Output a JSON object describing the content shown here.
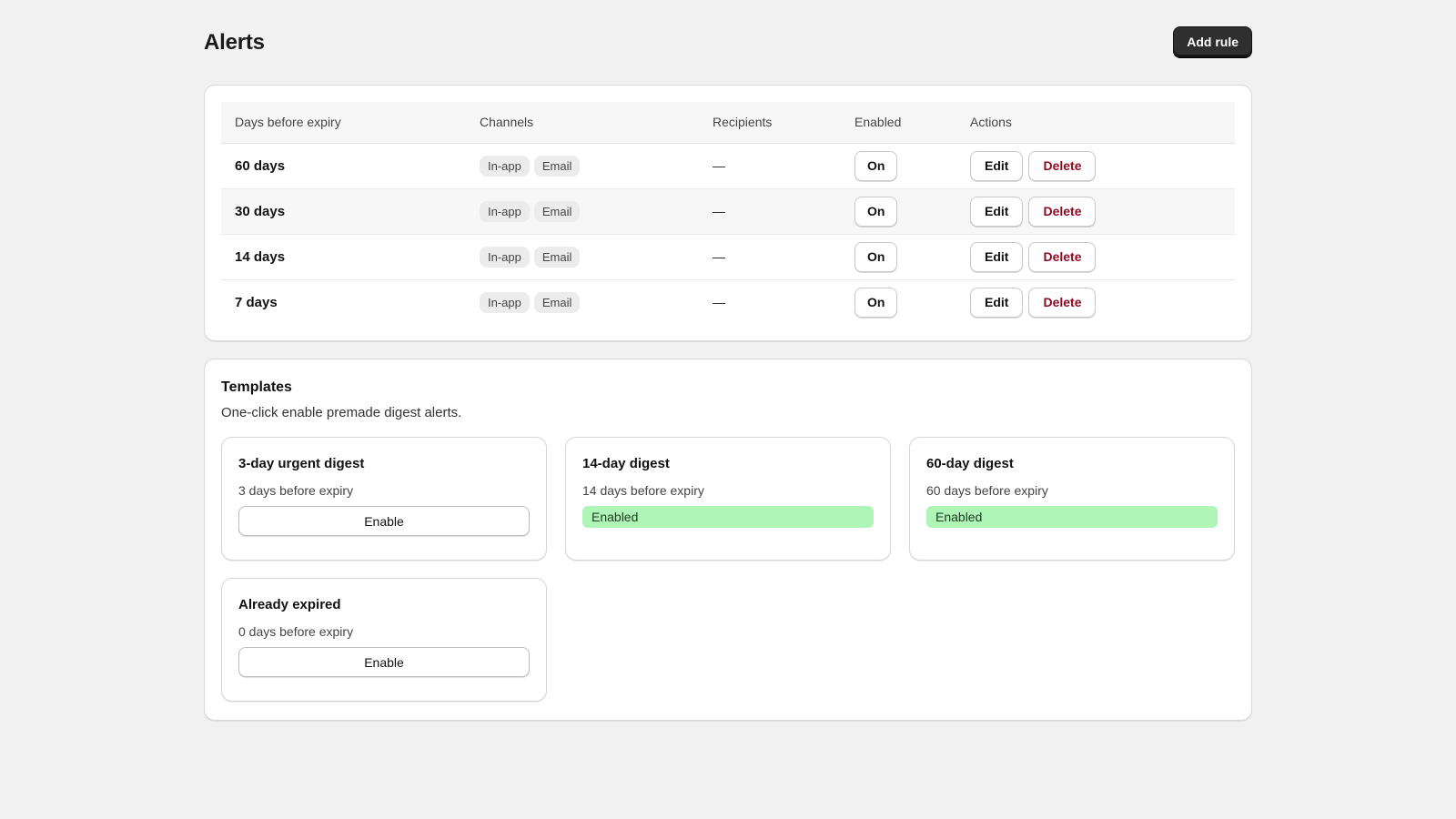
{
  "page": {
    "title": "Alerts",
    "add_rule_label": "Add rule"
  },
  "rules_table": {
    "headers": [
      "Days before expiry",
      "Channels",
      "Recipients",
      "Enabled",
      "Actions"
    ],
    "rows": [
      {
        "days": "60 days",
        "channels": [
          "In-app",
          "Email"
        ],
        "recipients": "—",
        "enabled": "On",
        "edit": "Edit",
        "delete": "Delete"
      },
      {
        "days": "30 days",
        "channels": [
          "In-app",
          "Email"
        ],
        "recipients": "—",
        "enabled": "On",
        "edit": "Edit",
        "delete": "Delete"
      },
      {
        "days": "14 days",
        "channels": [
          "In-app",
          "Email"
        ],
        "recipients": "—",
        "enabled": "On",
        "edit": "Edit",
        "delete": "Delete"
      },
      {
        "days": "7 days",
        "channels": [
          "In-app",
          "Email"
        ],
        "recipients": "—",
        "enabled": "On",
        "edit": "Edit",
        "delete": "Delete"
      }
    ]
  },
  "templates": {
    "title": "Templates",
    "subtitle": "One-click enable premade digest alerts.",
    "items": [
      {
        "title": "3-day urgent digest",
        "subtitle": "3 days before expiry",
        "status": "Enable",
        "enabled": false
      },
      {
        "title": "14-day digest",
        "subtitle": "14 days before expiry",
        "status": "Enabled",
        "enabled": true
      },
      {
        "title": "60-day digest",
        "subtitle": "60 days before expiry",
        "status": "Enabled",
        "enabled": true
      },
      {
        "title": "Already expired",
        "subtitle": "0 days before expiry",
        "status": "Enable",
        "enabled": false
      }
    ]
  },
  "colors": {
    "primary_button": "#2f2f2f",
    "delete_text": "#8e0b21",
    "enabled_badge": "#aff5b8"
  }
}
